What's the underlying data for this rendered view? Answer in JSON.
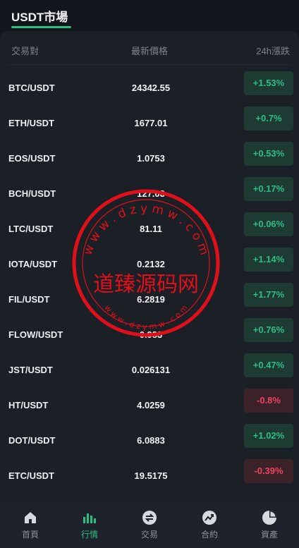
{
  "header": {
    "title": "USDT市場"
  },
  "columns": {
    "pair": "交易對",
    "price": "最新價格",
    "change": "24h漲跌"
  },
  "markets": [
    {
      "pair": "BTC/USDT",
      "price": "24342.55",
      "change": "+1.53%",
      "dir": "up"
    },
    {
      "pair": "ETH/USDT",
      "price": "1677.01",
      "change": "+0.7%",
      "dir": "up"
    },
    {
      "pair": "EOS/USDT",
      "price": "1.0753",
      "change": "+0.53%",
      "dir": "up"
    },
    {
      "pair": "BCH/USDT",
      "price": "127.03",
      "change": "+0.17%",
      "dir": "up"
    },
    {
      "pair": "LTC/USDT",
      "price": "81.11",
      "change": "+0.06%",
      "dir": "up"
    },
    {
      "pair": "IOTA/USDT",
      "price": "0.2132",
      "change": "+1.14%",
      "dir": "up"
    },
    {
      "pair": "FIL/USDT",
      "price": "6.2819",
      "change": "+1.77%",
      "dir": "up"
    },
    {
      "pair": "FLOW/USDT",
      "price": "0.983",
      "change": "+0.76%",
      "dir": "up"
    },
    {
      "pair": "JST/USDT",
      "price": "0.026131",
      "change": "+0.47%",
      "dir": "up"
    },
    {
      "pair": "HT/USDT",
      "price": "4.0259",
      "change": "-0.8%",
      "dir": "down"
    },
    {
      "pair": "DOT/USDT",
      "price": "6.0883",
      "change": "+1.02%",
      "dir": "up"
    },
    {
      "pair": "ETC/USDT",
      "price": "19.5175",
      "change": "-0.39%",
      "dir": "down"
    }
  ],
  "watermark": {
    "text": "道臻源码网",
    "url_top": "w w w . d z y m w . c o m",
    "url_bottom": "w w w . d z y m w . c o m",
    "color": "#e0101a"
  },
  "tabs": [
    {
      "label": "首頁",
      "icon": "home-icon"
    },
    {
      "label": "行情",
      "icon": "market-chart-icon",
      "active": true
    },
    {
      "label": "交易",
      "icon": "trade-icon"
    },
    {
      "label": "合約",
      "icon": "contract-icon"
    },
    {
      "label": "資產",
      "icon": "assets-pie-icon"
    }
  ],
  "colors": {
    "up": "#2ebd85",
    "down": "#f0435f",
    "accent": "#2ebd85"
  }
}
